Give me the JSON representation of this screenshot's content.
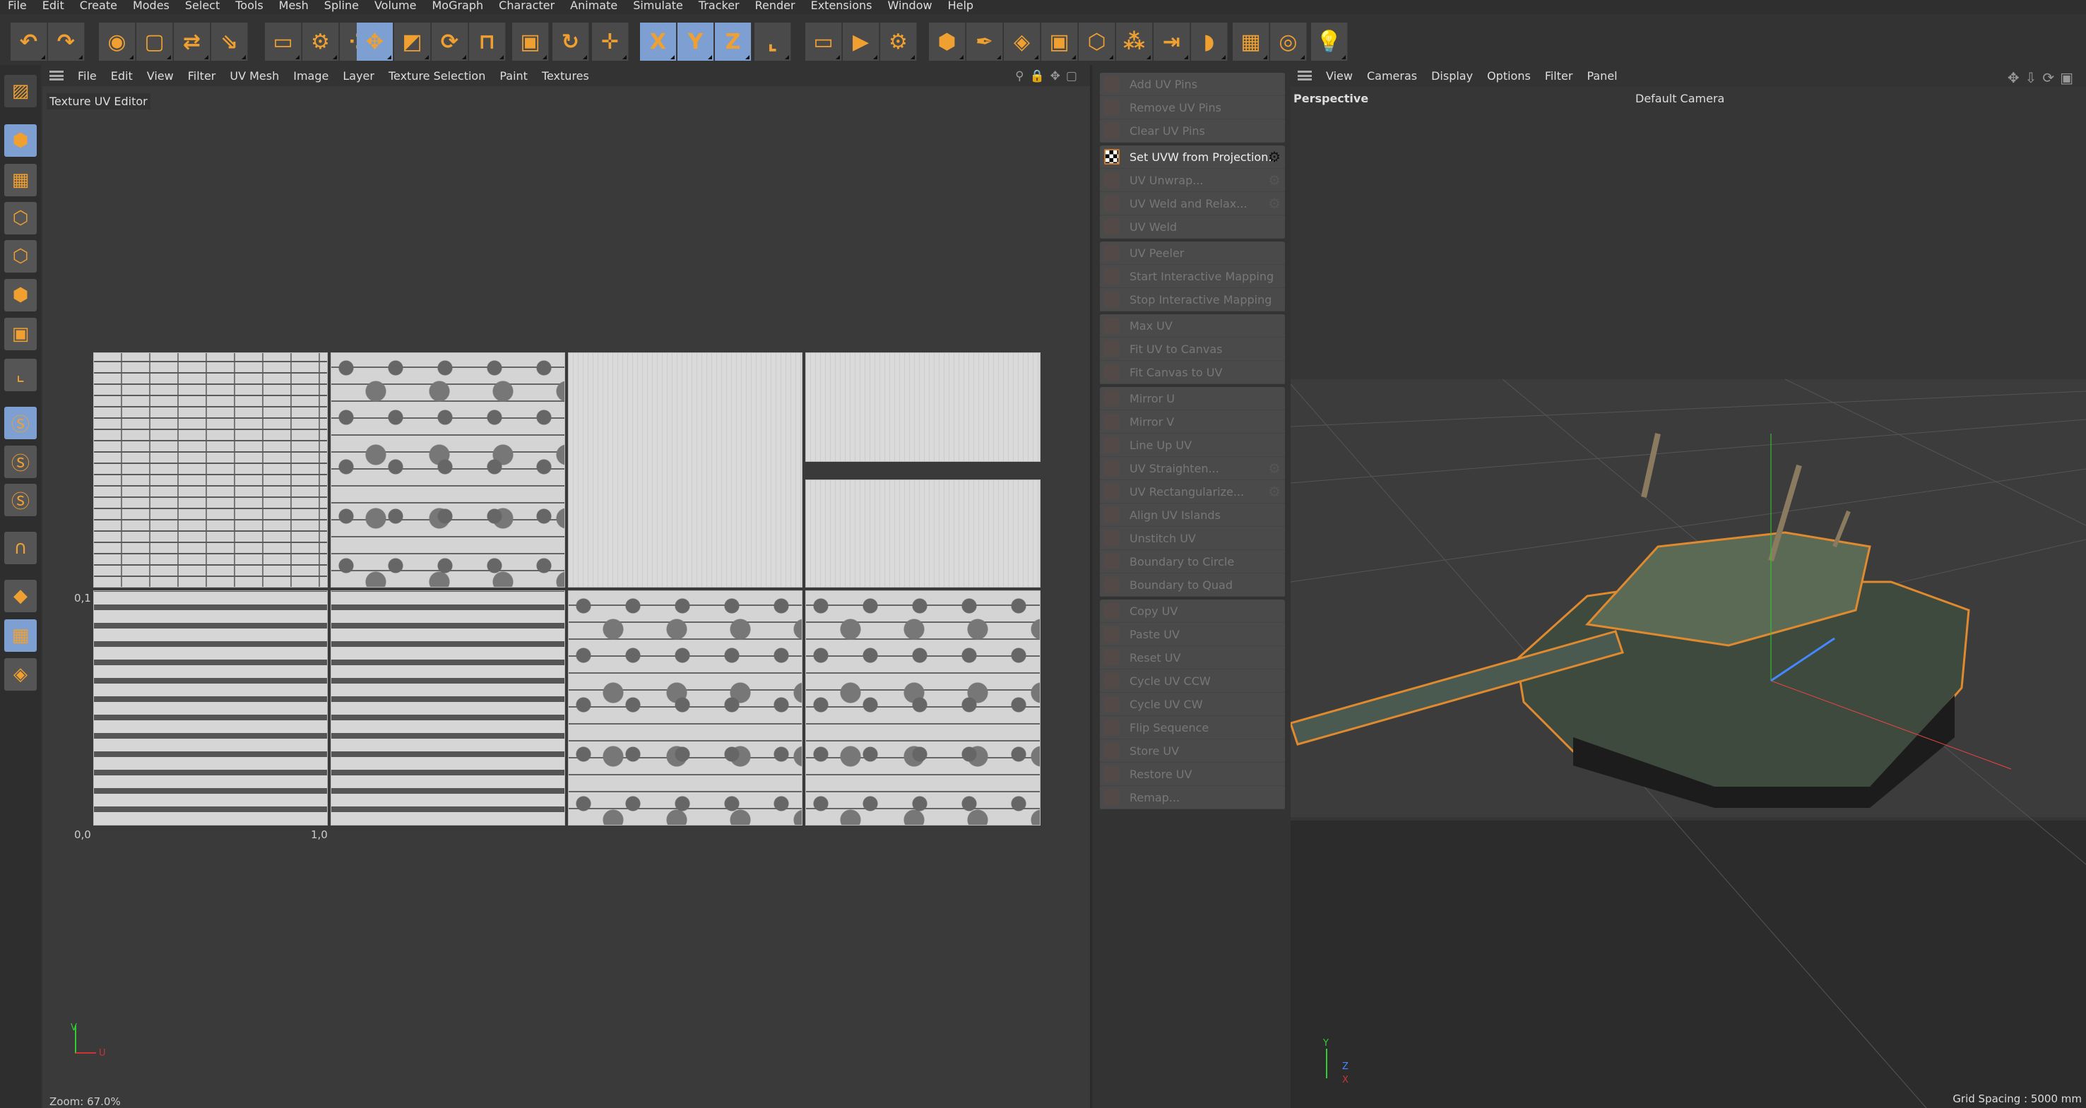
{
  "menubar": [
    "File",
    "Edit",
    "Create",
    "Modes",
    "Select",
    "Tools",
    "Mesh",
    "Spline",
    "Volume",
    "MoGraph",
    "Character",
    "Animate",
    "Simulate",
    "Tracker",
    "Render",
    "Extensions",
    "Window",
    "Help"
  ],
  "toolbar": [
    {
      "name": "undo-icon",
      "g": "↶",
      "on": false
    },
    {
      "name": "redo-icon",
      "g": "↷",
      "on": false
    },
    {
      "name": "live-selection-icon",
      "g": "◉",
      "on": false
    },
    {
      "name": "box-icon",
      "g": "▢",
      "on": false
    },
    {
      "name": "selection-filter-icon",
      "g": "⇄",
      "on": false
    },
    {
      "name": "transfer-icon",
      "g": "⇘",
      "on": false
    },
    {
      "name": "enable-axis-icon",
      "g": "▭",
      "on": false
    },
    {
      "name": "workplane-icon",
      "g": "⚙",
      "on": false
    },
    {
      "name": "points-icon",
      "g": "⁘",
      "on": false
    },
    {
      "name": "move-icon",
      "g": "✥",
      "on": true
    },
    {
      "name": "scale-icon",
      "g": "◩",
      "on": false
    },
    {
      "name": "rotate-icon",
      "g": "⟳",
      "on": false
    },
    {
      "name": "snap-icon",
      "g": "⊓",
      "on": false
    },
    {
      "name": "frame-icon",
      "g": "▣",
      "on": false
    },
    {
      "name": "psr-reset-icon",
      "g": "↻",
      "on": false
    },
    {
      "name": "axis-move-icon",
      "g": "✛",
      "on": false
    },
    {
      "name": "x-axis-icon",
      "g": "X",
      "on": true
    },
    {
      "name": "y-axis-icon",
      "g": "Y",
      "on": true
    },
    {
      "name": "z-axis-icon",
      "g": "Z",
      "on": true
    },
    {
      "name": "coordinate-system-icon",
      "g": "⌞",
      "on": false
    },
    {
      "name": "render-view-icon",
      "g": "▭",
      "on": false
    },
    {
      "name": "render-picture-viewer-icon",
      "g": "▶",
      "on": false
    },
    {
      "name": "render-settings-icon",
      "g": "⚙",
      "on": false
    },
    {
      "name": "cube-icon",
      "g": "⬢",
      "on": false
    },
    {
      "name": "pen-icon",
      "g": "✒",
      "on": false
    },
    {
      "name": "subdivision-icon",
      "g": "◈",
      "on": false
    },
    {
      "name": "extrude-icon",
      "g": "▣",
      "on": false
    },
    {
      "name": "array-icon",
      "g": "⬡",
      "on": false
    },
    {
      "name": "cloner-icon",
      "g": "⁂",
      "on": false
    },
    {
      "name": "deformer-icon",
      "g": "⇥",
      "on": false
    },
    {
      "name": "bend-icon",
      "g": "◗",
      "on": false
    },
    {
      "name": "floor-icon",
      "g": "▦",
      "on": false
    },
    {
      "name": "camera-icon",
      "g": "◎",
      "on": false
    },
    {
      "name": "light-icon",
      "g": "💡",
      "on": false
    }
  ],
  "uv_editor": {
    "menu": [
      "File",
      "Edit",
      "View",
      "Filter",
      "UV Mesh",
      "Image",
      "Layer",
      "Texture Selection",
      "Paint",
      "Textures"
    ],
    "title": "Texture UV Editor",
    "labels": {
      "v1": "0,1",
      "origin": "0,0",
      "u1": "1,0"
    },
    "axis": {
      "v": "V",
      "u": "U"
    },
    "zoom": "Zoom: 67.0%"
  },
  "commands": [
    [
      {
        "label": "Add UV Pins"
      },
      {
        "label": "Remove UV Pins"
      },
      {
        "label": "Clear UV Pins"
      }
    ],
    [
      {
        "label": "Set UVW from Projection...",
        "active": true,
        "gear": true
      },
      {
        "label": "UV Unwrap...",
        "gear": true
      },
      {
        "label": "UV Weld and Relax...",
        "gear": true
      },
      {
        "label": "UV Weld"
      }
    ],
    [
      {
        "label": "UV Peeler"
      },
      {
        "label": "Start Interactive Mapping"
      },
      {
        "label": "Stop Interactive Mapping"
      }
    ],
    [
      {
        "label": "Max UV"
      },
      {
        "label": "Fit UV to Canvas"
      },
      {
        "label": "Fit Canvas to UV"
      }
    ],
    [
      {
        "label": "Mirror U"
      },
      {
        "label": "Mirror V"
      },
      {
        "label": "Line Up UV"
      },
      {
        "label": "UV Straighten...",
        "gear": true
      },
      {
        "label": "UV Rectangularize...",
        "gear": true
      },
      {
        "label": "Align UV Islands"
      },
      {
        "label": "Unstitch UV"
      },
      {
        "label": "Boundary to Circle"
      },
      {
        "label": "Boundary to Quad"
      }
    ],
    [
      {
        "label": "Copy UV"
      },
      {
        "label": "Paste UV"
      },
      {
        "label": "Reset UV"
      },
      {
        "label": "Cycle UV CCW"
      },
      {
        "label": "Cycle UV CW"
      },
      {
        "label": "Flip Sequence"
      },
      {
        "label": "Store UV"
      },
      {
        "label": "Restore UV"
      },
      {
        "label": "Remap..."
      }
    ]
  ],
  "viewport": {
    "menu": [
      "View",
      "Cameras",
      "Display",
      "Options",
      "Filter",
      "Panel"
    ],
    "projection": "Perspective",
    "camera": "Default Camera",
    "grid_spacing": "Grid Spacing : 5000 mm",
    "axes": {
      "x": "X",
      "y": "Y",
      "z": "Z"
    }
  },
  "colors": {
    "accent": "#f0a030",
    "active_blue": "#7d9fd2",
    "selection_outline": "#e08a30"
  }
}
